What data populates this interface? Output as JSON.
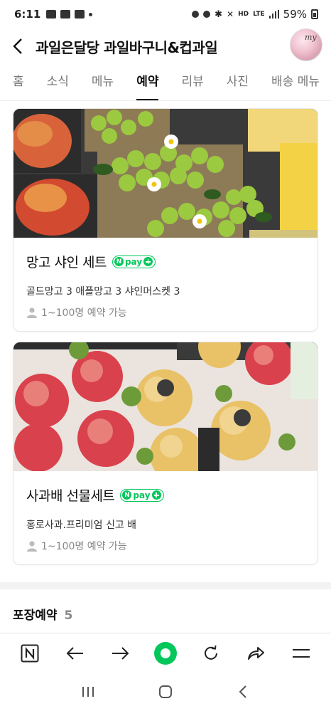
{
  "status": {
    "time": "6:11",
    "network_hd": "HD",
    "network_lte": "LTE",
    "battery_pct": "59%"
  },
  "header": {
    "title": "과일은달당 과일바구니&컵과일",
    "avatar_text": "my"
  },
  "tabs": [
    {
      "label": "홈"
    },
    {
      "label": "소식"
    },
    {
      "label": "메뉴"
    },
    {
      "label": "예약",
      "active": true
    },
    {
      "label": "리뷰"
    },
    {
      "label": "사진"
    },
    {
      "label": "배송 메뉴"
    }
  ],
  "products": [
    {
      "title": "망고 샤인 세트",
      "npay_text": "pay",
      "description": "골드망고 3 애플망고 3 샤인머스켓 3",
      "capacity": "1~100명 예약 가능"
    },
    {
      "title": "사과배 선물세트",
      "npay_text": "pay",
      "description": "홍로사과.프리미엄 신고 배",
      "capacity": "1~100명 예약 가능"
    }
  ],
  "section": {
    "title": "포장예약",
    "count": "5"
  },
  "colors": {
    "accent": "#03c75a",
    "text": "#111111",
    "muted": "#888888"
  }
}
